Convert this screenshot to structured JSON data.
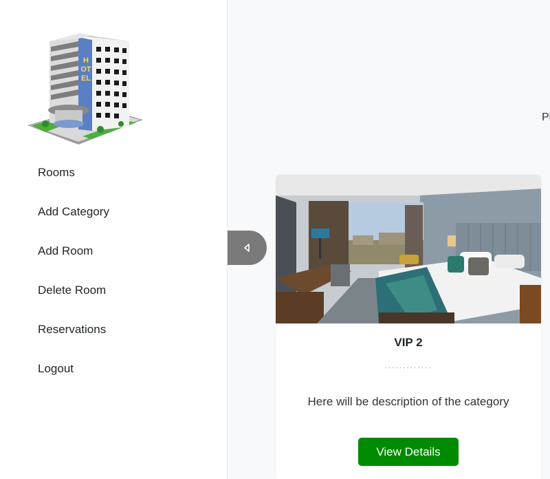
{
  "sidebar": {
    "logo_sign": "HOTEL",
    "items": [
      {
        "label": "Rooms"
      },
      {
        "label": "Add Category"
      },
      {
        "label": "Add Room"
      },
      {
        "label": "Delete Room"
      },
      {
        "label": "Reservations"
      },
      {
        "label": "Logout"
      }
    ]
  },
  "main": {
    "clipped_text": "Pl",
    "card": {
      "title": "VIP 2",
      "divider": ".............",
      "description": "Here will be description of the category",
      "button_label": "View Details"
    }
  },
  "colors": {
    "button": "#008a00",
    "toggle": "#7a7a7a",
    "sidebar_bg": "#ffffff",
    "page_bg": "#f8f9fa"
  },
  "icons": {
    "toggle": "caret-left-icon",
    "logo": "hotel-building-logo"
  }
}
